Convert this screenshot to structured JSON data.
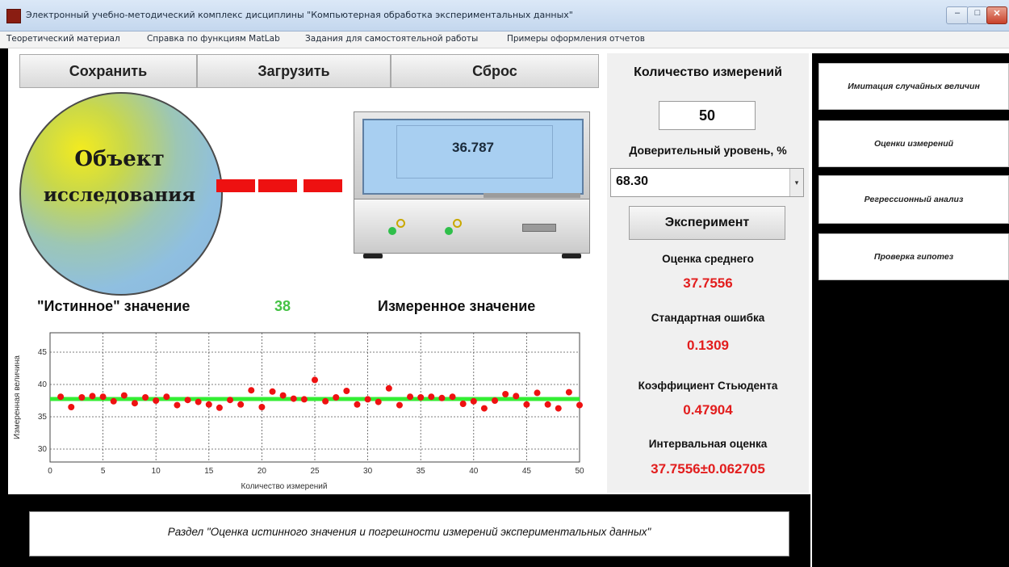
{
  "window": {
    "title": "Электронный учебно-методический комплекс дисциплины \"Компьютерная обработка экспериментальных данных\"",
    "min_glyph": "–",
    "max_glyph": "□",
    "close_glyph": "✕"
  },
  "menu": [
    "Теоретический материал",
    "Справка по функциям MatLab",
    "Задания для самостоятельной работы",
    "Примеры оформления отчетов"
  ],
  "toolbar": {
    "save_label": "Сохранить",
    "load_label": "Загрузить",
    "reset_label": "Сброс"
  },
  "object": {
    "line1": "Объект",
    "line2": "исследования"
  },
  "instrument": {
    "display_value": "36.787"
  },
  "labels": {
    "true_value_label": "\"Истинное\" значение",
    "true_value": "38",
    "measured_value_label": "Измеренное значение"
  },
  "controls": {
    "count_label": "Количество измерений",
    "count_value": "50",
    "confidence_label": "Доверительный уровень, %",
    "confidence_value": "68.30",
    "experiment_button": "Эксперимент"
  },
  "stats": {
    "mean_label": "Оценка среднего",
    "mean_value": "37.7556",
    "std_error_label": "Стандартная ошибка",
    "std_error_value": "0.1309",
    "student_label": "Коэффициент Стьюдента",
    "student_value": "0.47904",
    "interval_label": "Интервальная оценка",
    "interval_value": "37.7556±0.062705"
  },
  "nav": [
    "Имитация случайных величин",
    "Оценки измерений",
    "Регрессионный анализ",
    "Проверка гипотез"
  ],
  "footer": {
    "section_text": "Раздел \"Оценка истинного значения и погрешности измерений экспериментальных данных\""
  },
  "colors": {
    "accent_red": "#e21d1d",
    "true_value_green": "#44c244",
    "mean_line": "#33ee33",
    "point": "#ee1111"
  },
  "chart_data": {
    "type": "scatter",
    "xlabel": "Количество измерений",
    "ylabel": "Измеренная величина",
    "xlim": [
      0,
      50
    ],
    "ylim": [
      28,
      48
    ],
    "xticks": [
      0,
      5,
      10,
      15,
      20,
      25,
      30,
      35,
      40,
      45,
      50
    ],
    "yticks": [
      30,
      35,
      40,
      45
    ],
    "grid": true,
    "mean_line_y": 37.7556,
    "x": [
      1,
      2,
      3,
      4,
      5,
      6,
      7,
      8,
      9,
      10,
      11,
      12,
      13,
      14,
      15,
      16,
      17,
      18,
      19,
      20,
      21,
      22,
      23,
      24,
      25,
      26,
      27,
      28,
      29,
      30,
      31,
      32,
      33,
      34,
      35,
      36,
      37,
      38,
      39,
      40,
      41,
      42,
      43,
      44,
      45,
      46,
      47,
      48,
      49,
      50
    ],
    "y": [
      38.1,
      36.5,
      38.0,
      38.2,
      38.1,
      37.4,
      38.3,
      37.1,
      38.0,
      37.5,
      38.1,
      36.8,
      37.6,
      37.3,
      36.9,
      36.4,
      37.6,
      36.9,
      39.1,
      36.5,
      38.9,
      38.3,
      37.8,
      37.7,
      40.7,
      37.4,
      38.0,
      39.0,
      36.9,
      37.7,
      37.3,
      39.4,
      36.8,
      38.1,
      38.0,
      38.1,
      37.9,
      38.1,
      37.0,
      37.4,
      36.3,
      37.5,
      38.5,
      38.2,
      36.9,
      38.7,
      36.9,
      36.3,
      38.8,
      36.8
    ]
  }
}
